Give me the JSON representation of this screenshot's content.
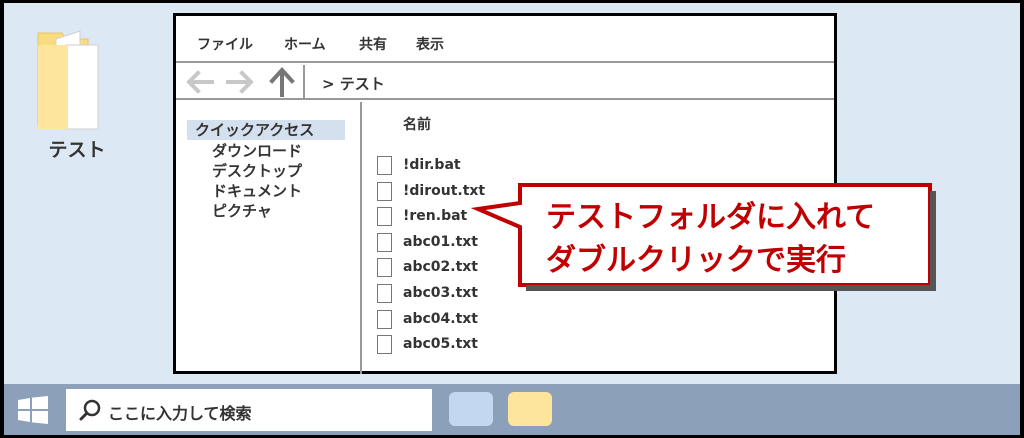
{
  "desktop": {
    "folder_label": "テスト"
  },
  "window": {
    "menu": [
      "ファイル",
      "ホーム",
      "共有",
      "表示"
    ],
    "address": "> テスト",
    "nav": [
      {
        "label": "クイックアクセス",
        "selected": true
      },
      {
        "label": "ダウンロード",
        "selected": false
      },
      {
        "label": "デスクトップ",
        "selected": false
      },
      {
        "label": "ドキュメント",
        "selected": false
      },
      {
        "label": "ピクチャ",
        "selected": false
      }
    ],
    "column_header": "名前",
    "files": [
      "!dir.bat",
      "!dirout.txt",
      "!ren.bat",
      "abc01.txt",
      "abc02.txt",
      "abc03.txt",
      "abc04.txt",
      "abc05.txt"
    ]
  },
  "callout": {
    "line1": "テストフォルダに入れて",
    "line2": "ダブルクリックで実行"
  },
  "taskbar": {
    "search_placeholder": "ここに入力して検索",
    "apps": [
      {
        "name": "blue-app",
        "color": "#c3d8f0"
      },
      {
        "name": "yellow-app",
        "color": "#fde59c"
      }
    ]
  },
  "colors": {
    "desktop_bg": "#dde8f5",
    "taskbar_bg": "#8ca0b9",
    "accent_red": "#c00000",
    "folder_yellow": "#fde59c"
  },
  "icons": [
    "folder-icon",
    "back-arrow-icon",
    "forward-arrow-icon",
    "up-arrow-icon",
    "file-icon",
    "windows-logo-icon",
    "search-icon"
  ]
}
